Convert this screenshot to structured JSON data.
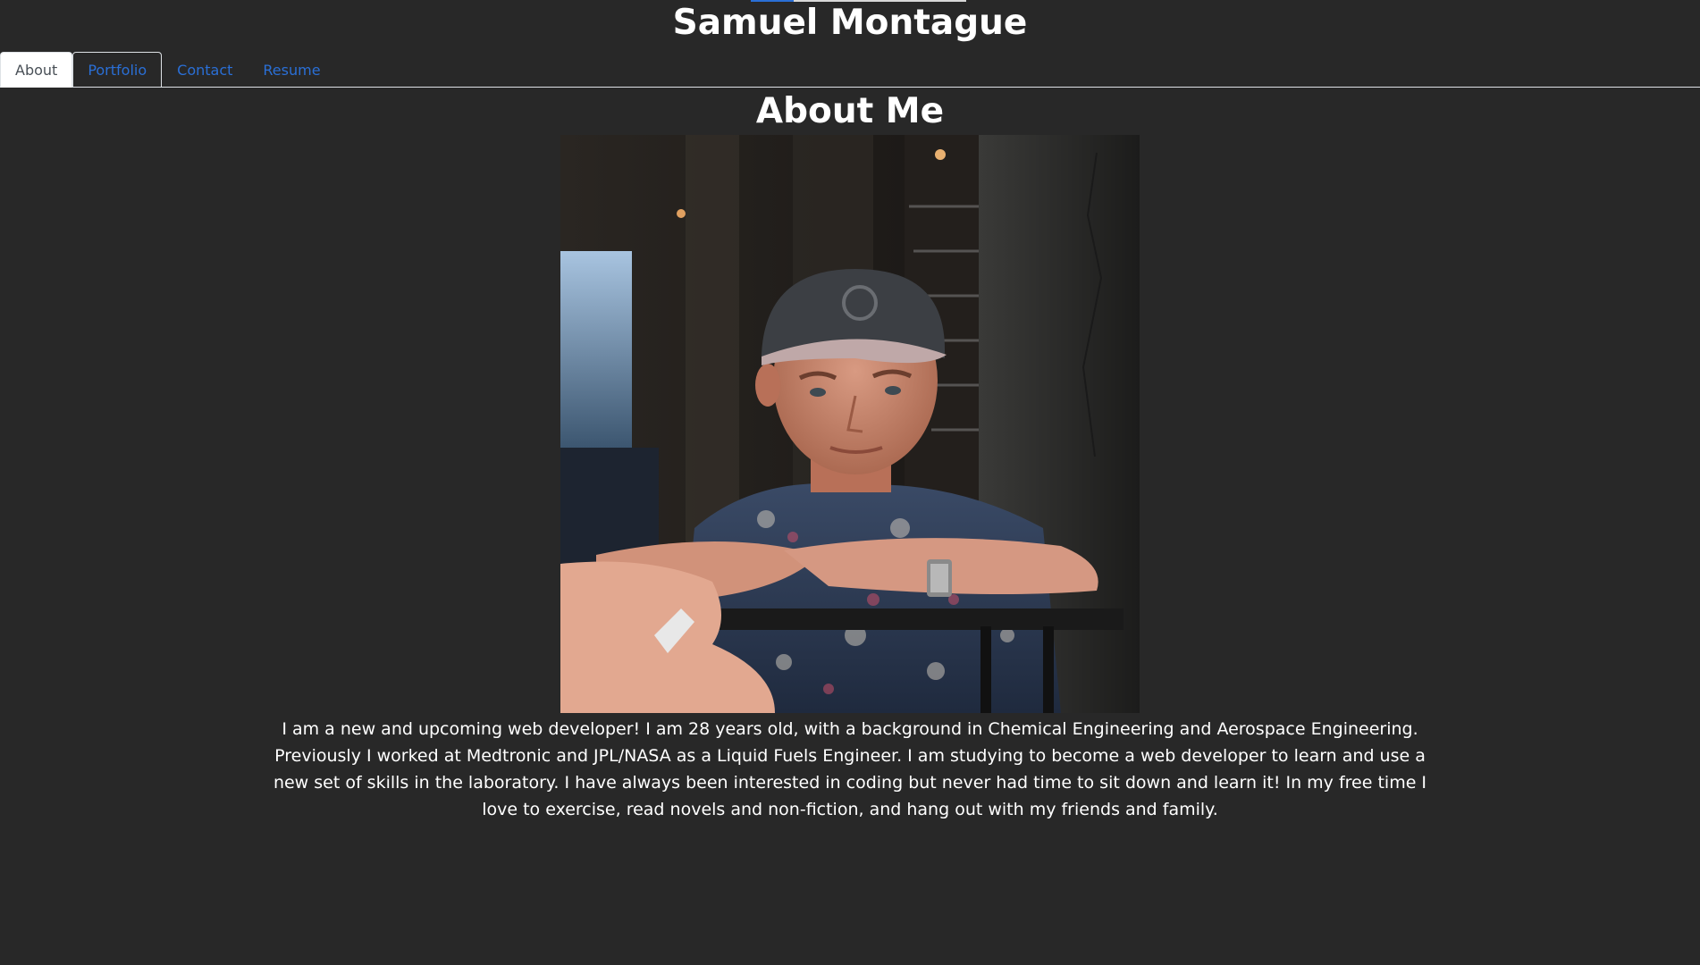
{
  "site": {
    "title": "Samuel Montague"
  },
  "nav": {
    "tabs": [
      {
        "label": "About",
        "active": true
      },
      {
        "label": "Portfolio",
        "active": false
      },
      {
        "label": "Contact",
        "active": false
      },
      {
        "label": "Resume",
        "active": false
      }
    ]
  },
  "about": {
    "heading": "About Me",
    "photo_icon": "profile-photo",
    "bio": "I am a new and upcoming web developer! I am 28 years old, with a background in Chemical Engineering and Aerospace Engineering. Previously I worked at Medtronic and JPL/NASA as a Liquid Fuels Engineer. I am studying to become a web developer to learn and use a new set of skills in the laboratory. I have always been interested in coding but never had time to sit down and learn it! In my free time I love to exercise, read novels and non-fiction, and hang out with my friends and family."
  },
  "colors": {
    "background": "#282828",
    "link": "#2a6fd6",
    "active_tab_bg": "#ffffff",
    "active_tab_text": "#495057"
  }
}
